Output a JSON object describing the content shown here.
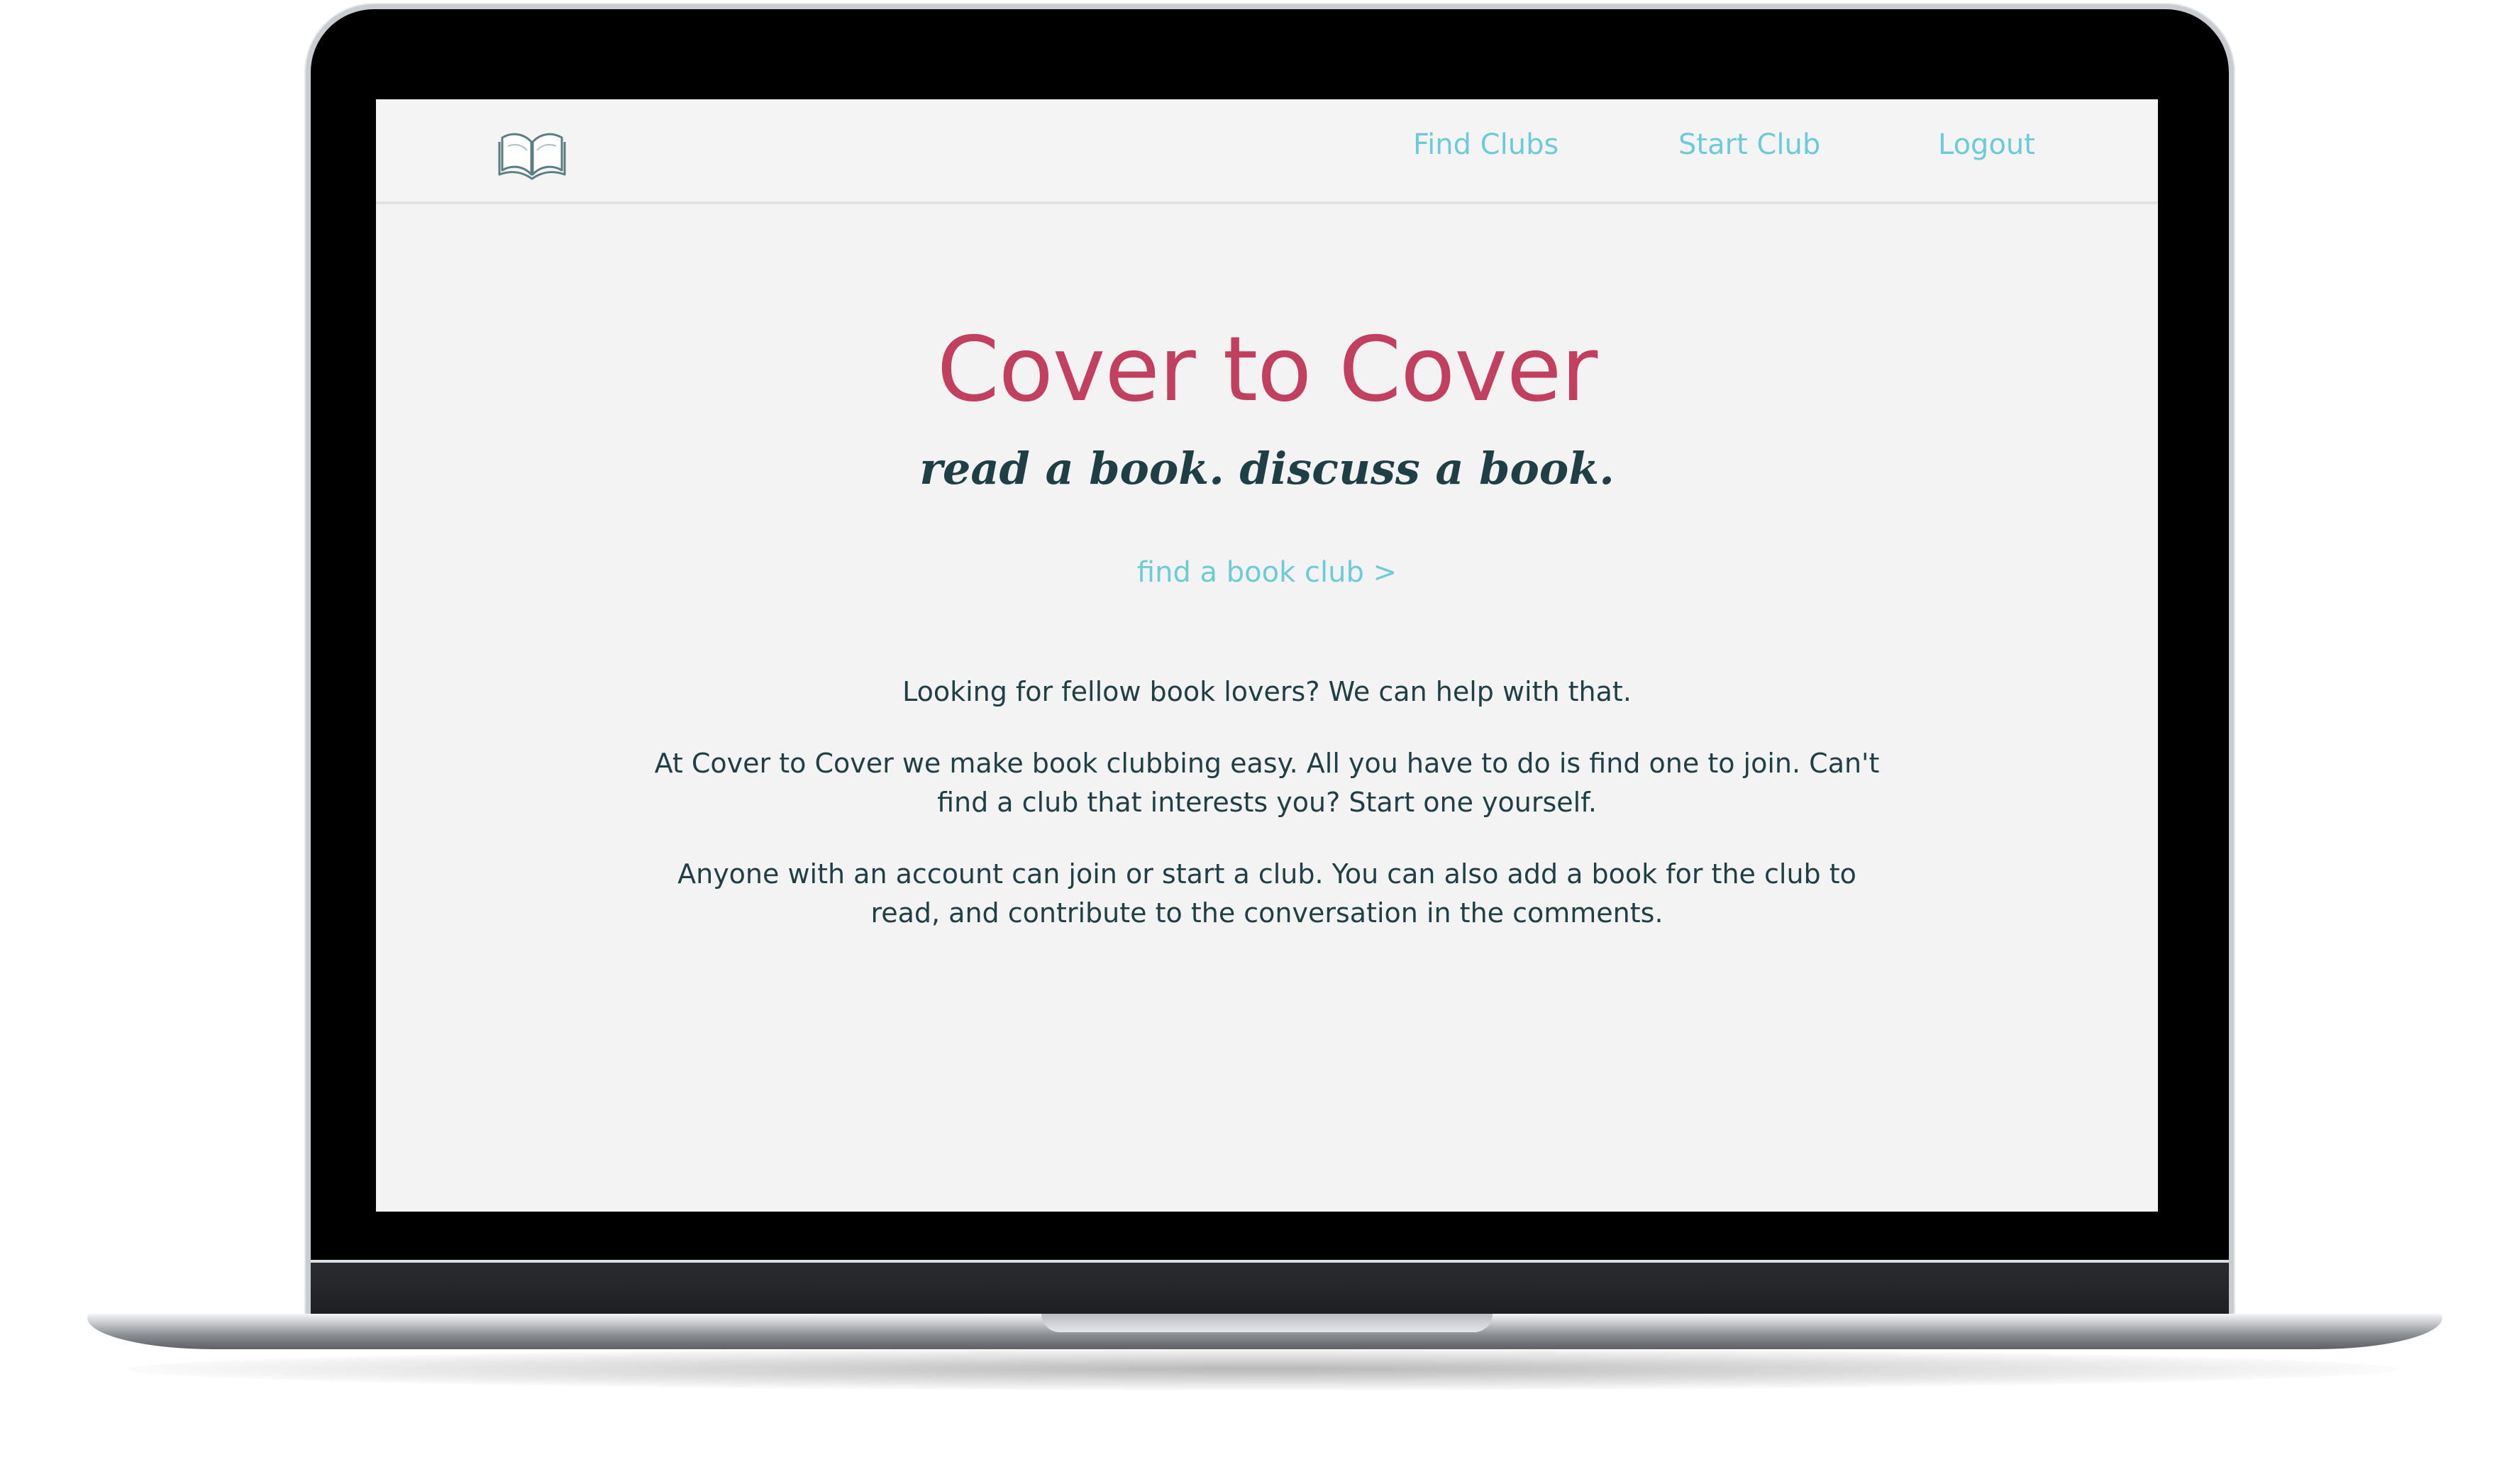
{
  "nav": {
    "logo_icon": "open-book-icon",
    "links": [
      {
        "label": "Find Clubs"
      },
      {
        "label": "Start Club"
      },
      {
        "label": "Logout"
      }
    ]
  },
  "hero": {
    "title": "Cover to Cover",
    "tagline": "read a book. discuss a book.",
    "cta": "find a book club >"
  },
  "intro": {
    "paragraphs": [
      "Looking for fellow book lovers? We can help with that.",
      "At Cover to Cover we make book clubbing easy. All you have to do is find one to join. Can't find a club that interests you? Start one yourself.",
      "Anyone with an account can join or start a club. You can also add a book for the club to read, and contribute to the conversation in the comments."
    ]
  },
  "colors": {
    "accent": "#6ccbd6",
    "brand": "#c2405f",
    "text": "#1f3f45",
    "background": "#f3f3f3"
  }
}
